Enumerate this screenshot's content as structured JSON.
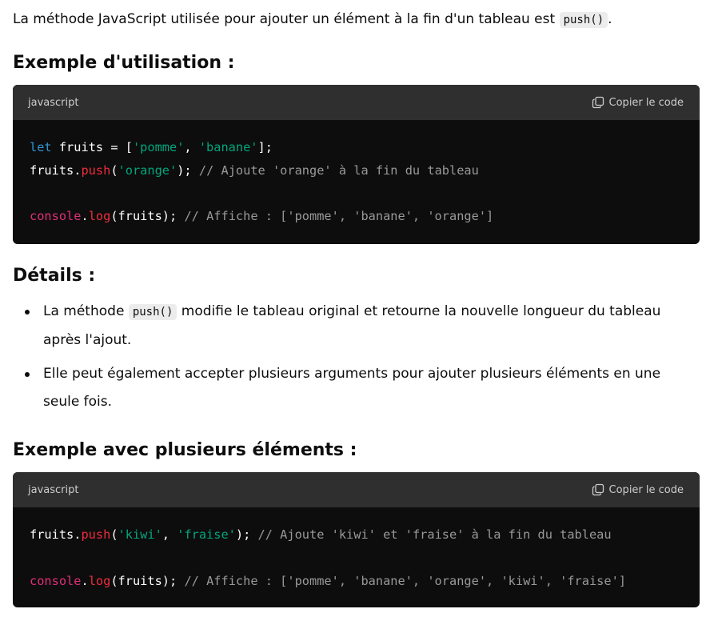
{
  "intro": {
    "text_before": "La méthode JavaScript utilisée pour ajouter un élément à la fin d'un tableau est ",
    "code": "push()",
    "text_after": "."
  },
  "section1": {
    "heading": "Exemple d'utilisation :"
  },
  "codeblock1": {
    "language": "javascript",
    "copy_label": "Copier le code",
    "copy_icon": "copy-icon",
    "lines": [
      [
        {
          "t": "let",
          "c": "kw"
        },
        {
          "t": " fruits = [",
          "c": ""
        },
        {
          "t": "'pomme'",
          "c": "str"
        },
        {
          "t": ", ",
          "c": ""
        },
        {
          "t": "'banane'",
          "c": "str"
        },
        {
          "t": "];",
          "c": ""
        }
      ],
      [
        {
          "t": "fruits.",
          "c": ""
        },
        {
          "t": "push",
          "c": "fn"
        },
        {
          "t": "(",
          "c": ""
        },
        {
          "t": "'orange'",
          "c": "str"
        },
        {
          "t": "); ",
          "c": ""
        },
        {
          "t": "// Ajoute 'orange' à la fin du tableau",
          "c": "cm"
        }
      ],
      [],
      [
        {
          "t": "console",
          "c": "con"
        },
        {
          "t": ".",
          "c": ""
        },
        {
          "t": "log",
          "c": "fn"
        },
        {
          "t": "(fruits); ",
          "c": ""
        },
        {
          "t": "// Affiche : ['pomme', 'banane', 'orange']",
          "c": "cm"
        }
      ]
    ]
  },
  "section2": {
    "heading": "Détails :"
  },
  "details": {
    "items": [
      {
        "before": "La méthode ",
        "code": "push()",
        "after": " modifie le tableau original et retourne la nouvelle longueur du tableau après l'ajout."
      },
      {
        "before": "Elle peut également accepter plusieurs arguments pour ajouter plusieurs éléments en une seule fois.",
        "code": "",
        "after": ""
      }
    ]
  },
  "section3": {
    "heading": "Exemple avec plusieurs éléments :"
  },
  "codeblock2": {
    "language": "javascript",
    "copy_label": "Copier le code",
    "copy_icon": "copy-icon",
    "lines": [
      [
        {
          "t": "fruits.",
          "c": ""
        },
        {
          "t": "push",
          "c": "fn"
        },
        {
          "t": "(",
          "c": ""
        },
        {
          "t": "'kiwi'",
          "c": "str"
        },
        {
          "t": ", ",
          "c": ""
        },
        {
          "t": "'fraise'",
          "c": "str"
        },
        {
          "t": "); ",
          "c": ""
        },
        {
          "t": "// Ajoute 'kiwi' et 'fraise' à la fin du tableau",
          "c": "cm"
        }
      ],
      [],
      [
        {
          "t": "console",
          "c": "con"
        },
        {
          "t": ".",
          "c": ""
        },
        {
          "t": "log",
          "c": "fn"
        },
        {
          "t": "(fruits); ",
          "c": ""
        },
        {
          "t": "// Affiche : ['pomme', 'banane', 'orange', 'kiwi', 'fraise']",
          "c": "cm"
        }
      ]
    ]
  },
  "colors": {
    "keyword": "#2e95d3",
    "string": "#00a67d",
    "function": "#f22c3d",
    "comment": "#999999",
    "console": "#df3079",
    "code_bg": "#0d0d0d",
    "code_header_bg": "#2f2f2f"
  }
}
